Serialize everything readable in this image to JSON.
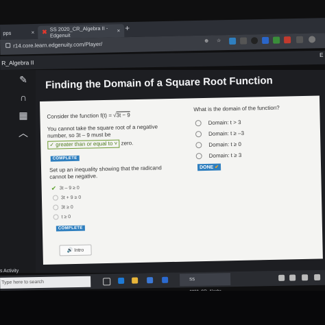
{
  "browser": {
    "tabs": [
      {
        "label": "pps",
        "close": "×"
      },
      {
        "label": "SS 2020_CR_Algebra II - Edgenuit",
        "close": "×"
      }
    ],
    "new_tab": "+",
    "url": "r14.core.learn.edgenuity.com/Player/"
  },
  "app": {
    "course": "R_Algebra II",
    "right_label": "E"
  },
  "lesson": {
    "title": "Finding the Domain of a Square Root Function"
  },
  "left": {
    "prompt_prefix": "Consider the function f(t) =",
    "prompt_radicand": "3t − 9",
    "prompt_sqrt": "√",
    "line1": "You cannot take the square root of a negative",
    "line2": "number, so 3t – 9 must be",
    "dropdown": "✓ greater than or equal to ˅",
    "line2_end": "zero.",
    "complete1": "COMPLETE",
    "setup1": "Set up an inequality showing that the radicand",
    "setup2": "cannot be negative.",
    "choices": [
      "3t – 9 ≥ 0",
      "3t + 9 ≥ 0",
      "3t ≥ 0",
      "t ≥ 0"
    ],
    "complete2": "COMPLETE",
    "intro_button": "Intro"
  },
  "right": {
    "question": "What is the domain of the function?",
    "options": [
      "Domain: t > 3",
      "Domain: t ≥ –3",
      "Domain: t ≥ 0",
      "Domain: t ≥ 3"
    ],
    "done": "DONE"
  },
  "footer": {
    "activity": "s Activity",
    "search_placeholder": "Type here to search",
    "taskbar_app": "SS 2020_CR_Algebr..."
  },
  "colors": {
    "accent_blue": "#2f7fbf",
    "check_green": "#5aa02c",
    "edgenuity_red": "#e2382e"
  }
}
